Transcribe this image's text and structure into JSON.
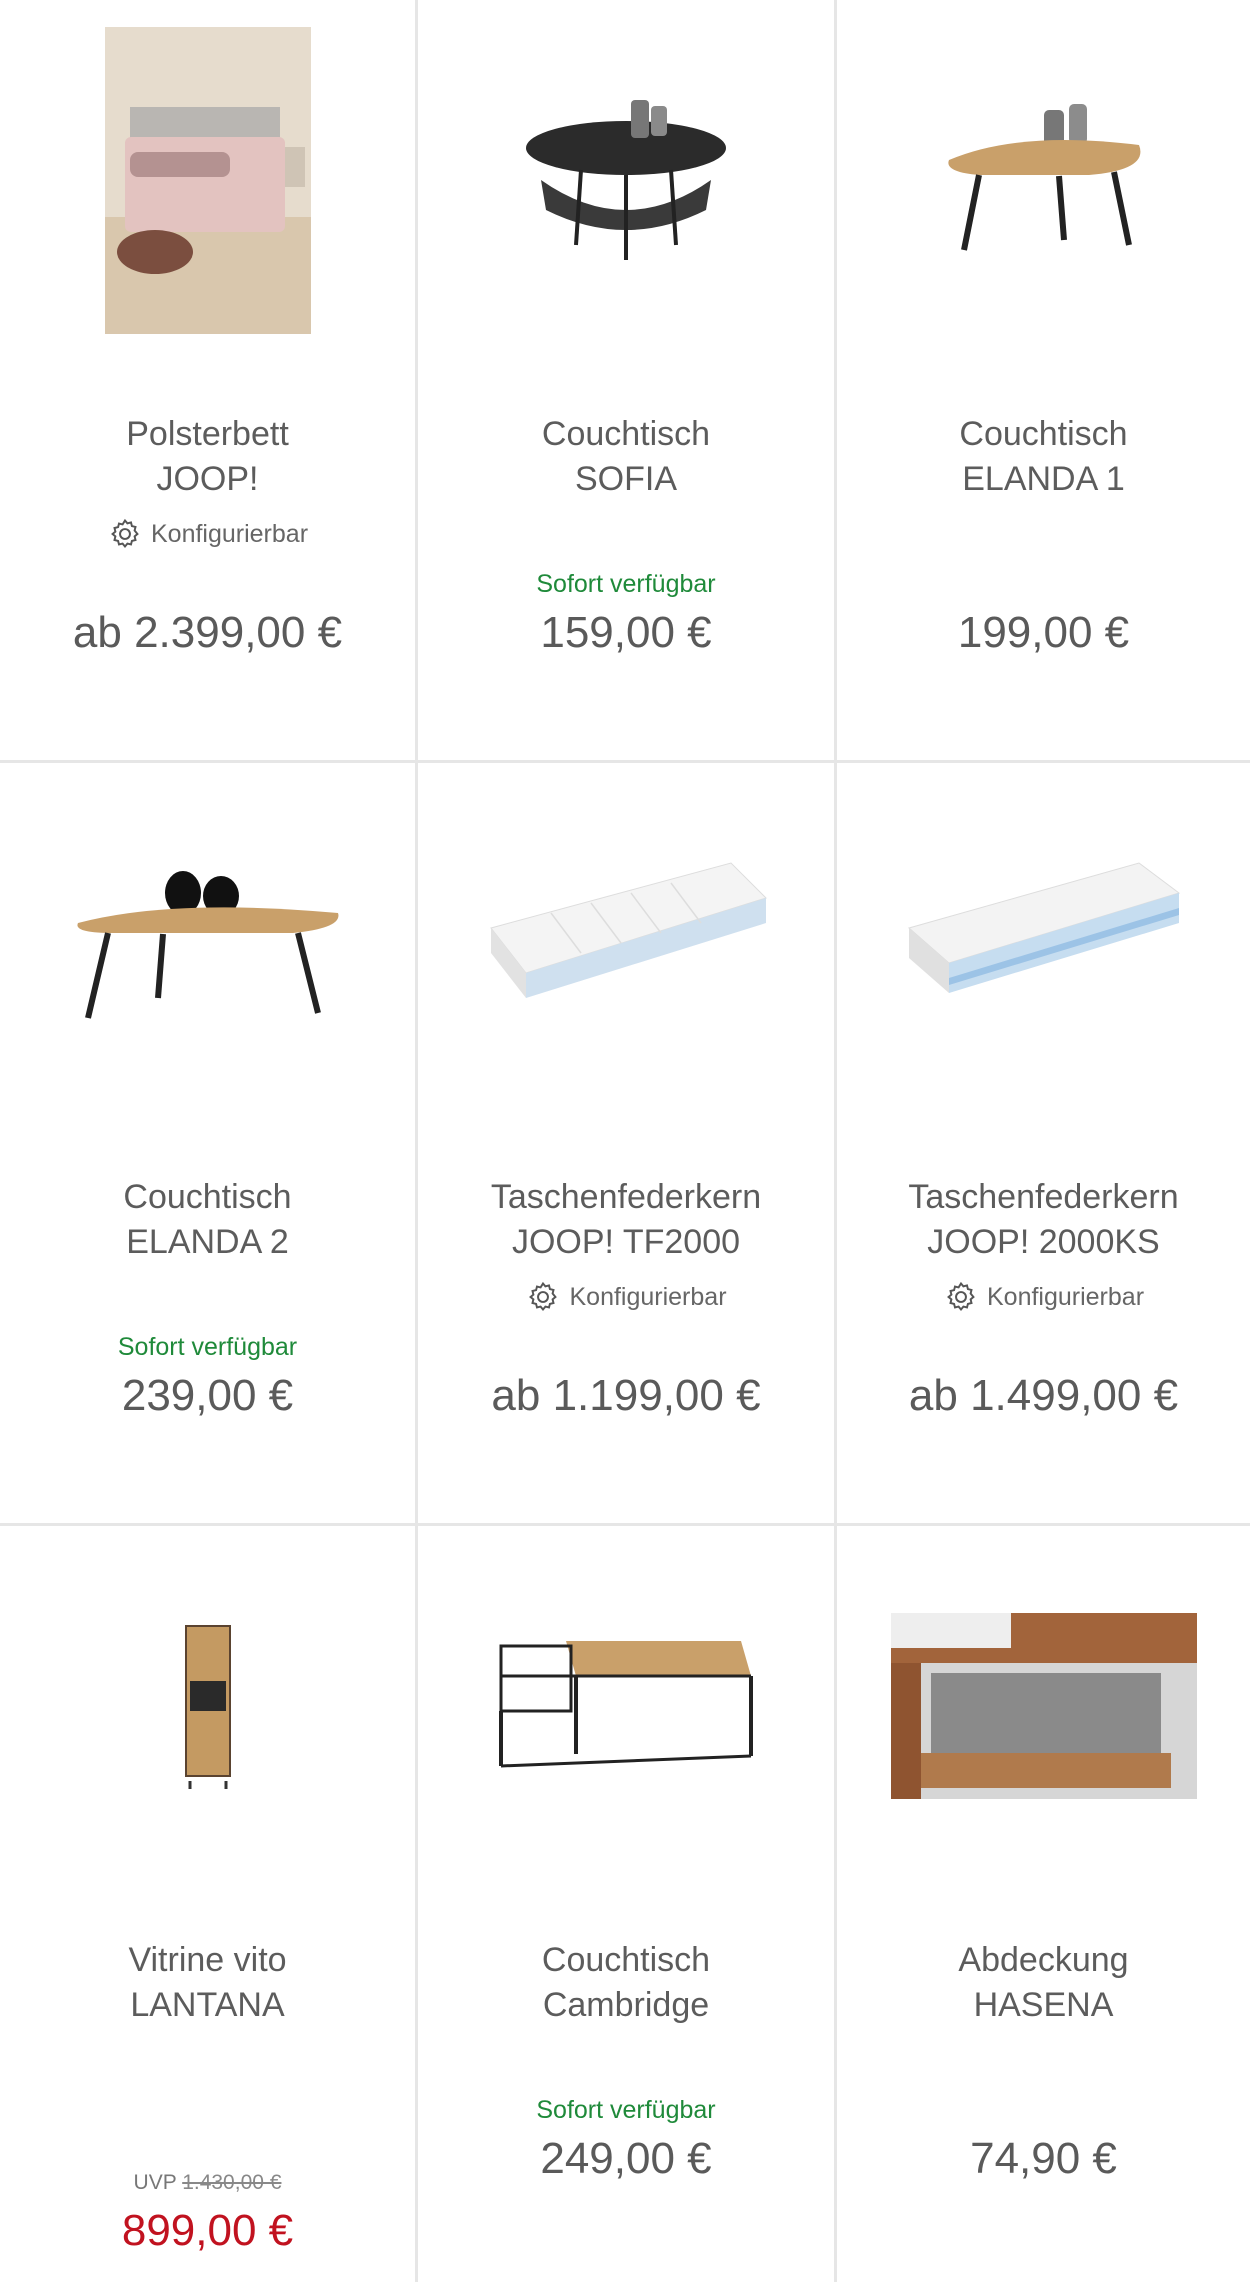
{
  "products": [
    {
      "name1": "Polsterbett",
      "name2": "JOOP!",
      "badge": "Konfigurierbar",
      "availability": "",
      "price": "ab 2.399,00 €"
    },
    {
      "name1": "Couchtisch",
      "name2": "SOFIA",
      "badge": "",
      "availability": "Sofort verfügbar",
      "price": "159,00 €"
    },
    {
      "name1": "Couchtisch",
      "name2": "ELANDA 1",
      "badge": "",
      "availability": "",
      "price": "199,00 €"
    },
    {
      "name1": "Couchtisch",
      "name2": "ELANDA 2",
      "badge": "",
      "availability": "Sofort verfügbar",
      "price": "239,00 €"
    },
    {
      "name1": "Taschenfederkern",
      "name2": "JOOP! TF2000",
      "badge": "Konfigurierbar",
      "availability": "",
      "price": "ab 1.199,00 €"
    },
    {
      "name1": "Taschenfederkern",
      "name2": "JOOP! 2000KS",
      "badge": "Konfigurierbar",
      "availability": "",
      "price": "ab 1.499,00 €"
    },
    {
      "name1": "Vitrine vito",
      "name2": "LANTANA",
      "badge": "",
      "availability": "",
      "uvp_label": "UVP",
      "uvp_price": "1.430,00 €",
      "price": "899,00 €"
    },
    {
      "name1": "Couchtisch",
      "name2": "Cambridge",
      "badge": "",
      "availability": "Sofort verfügbar",
      "price": "249,00 €"
    },
    {
      "name1": "Abdeckung",
      "name2": "HASENA",
      "badge": "",
      "availability": "",
      "price": "74,90 €"
    }
  ],
  "colors": {
    "availability": "#1f8a3a",
    "sale_price": "#c1121f",
    "divider": "#e6e6e6"
  },
  "icons": {
    "badge": "gear-icon"
  }
}
